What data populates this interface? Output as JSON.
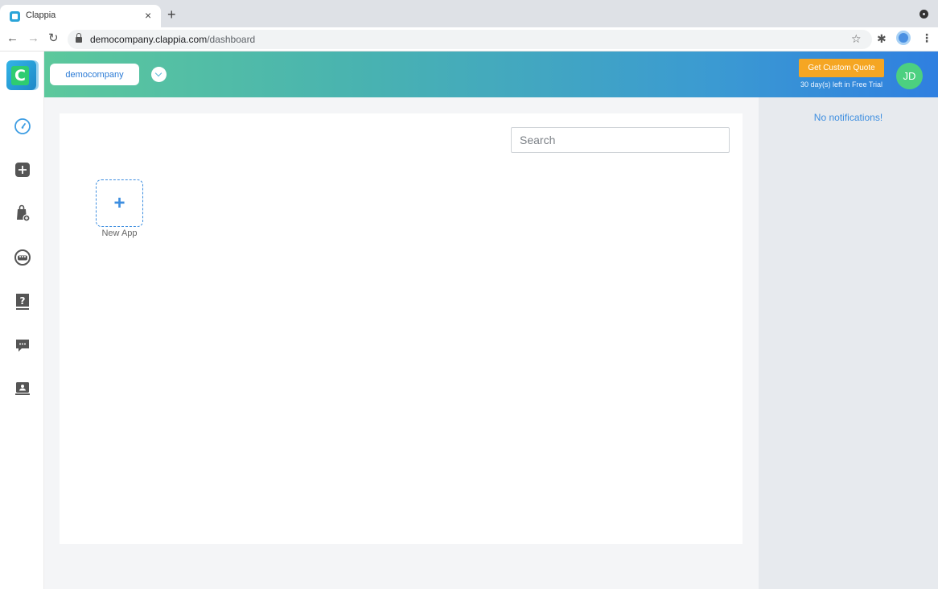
{
  "browser": {
    "tab_title": "Clappia",
    "tab_close": "×",
    "new_tab": "+",
    "url_host": "democompany.clappia.com",
    "url_path": "/dashboard"
  },
  "header": {
    "company_name": "democompany",
    "quote_button": "Get Custom Quote",
    "trial_text": "30 day(s) left in Free Trial",
    "avatar_initials": "JD"
  },
  "main": {
    "search_placeholder": "Search",
    "new_app_symbol": "+",
    "new_app_label": "New App"
  },
  "notifications": {
    "empty_text": "No notifications!"
  },
  "sidebar": {
    "items": [
      {
        "icon": "dashboard-gauge-icon"
      },
      {
        "icon": "add-app-icon"
      },
      {
        "icon": "marketplace-bag-icon"
      },
      {
        "icon": "users-group-icon"
      },
      {
        "icon": "help-book-icon"
      },
      {
        "icon": "chat-icon"
      },
      {
        "icon": "account-icon"
      }
    ]
  },
  "colors": {
    "accent": "#3d8ee0",
    "quote": "#f5a623",
    "avatar": "#4cd080"
  }
}
